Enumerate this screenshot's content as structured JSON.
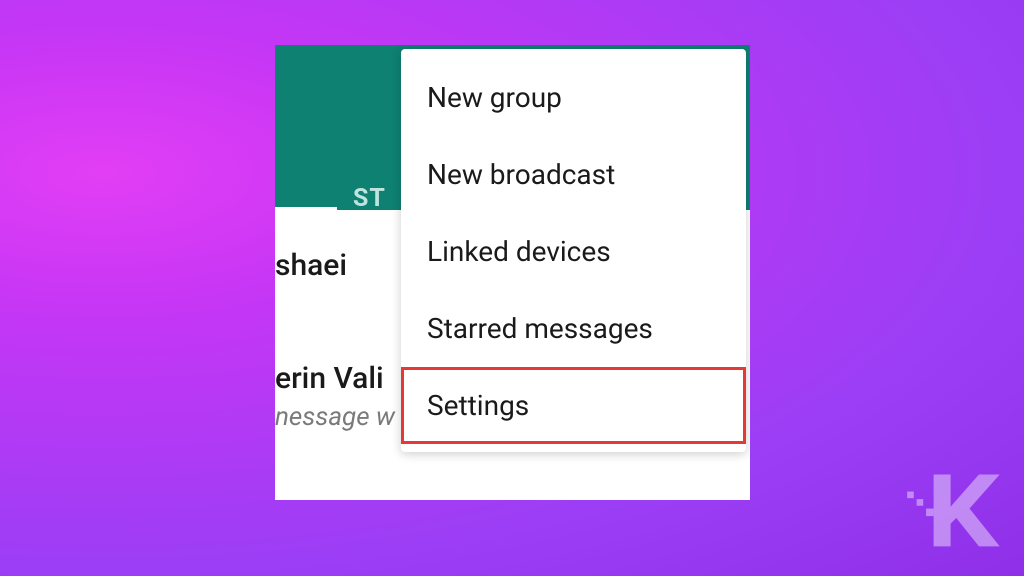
{
  "app": {
    "header": {
      "tab_partial": "ST"
    },
    "chats": [
      {
        "name_partial": "shaei"
      },
      {
        "name_partial": "erin Vali",
        "preview_partial": "nessage w"
      }
    ]
  },
  "menu": {
    "items": [
      {
        "label": "New group",
        "highlighted": false
      },
      {
        "label": "New broadcast",
        "highlighted": false
      },
      {
        "label": "Linked devices",
        "highlighted": false
      },
      {
        "label": "Starred messages",
        "highlighted": false
      },
      {
        "label": "Settings",
        "highlighted": true
      }
    ]
  },
  "watermark": {
    "label": "K"
  },
  "colors": {
    "header_bg": "#0e8173",
    "highlight_border": "#e53935"
  }
}
